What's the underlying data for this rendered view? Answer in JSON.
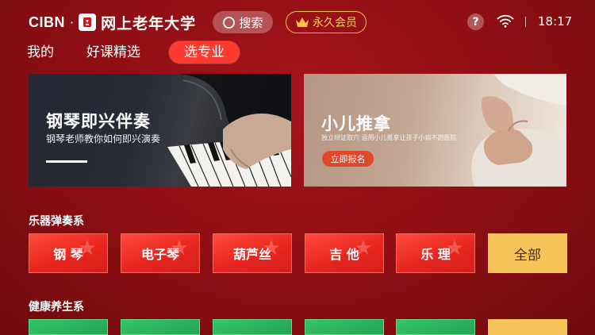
{
  "header": {
    "brand_cibn": "CIBN",
    "brand_dot": "·",
    "brand_name": "网上老年大学",
    "search_label": "搜索",
    "vip_label": "永久会员",
    "help_label": "?",
    "time": "18:17"
  },
  "tabs": [
    {
      "label": "我的",
      "active": false
    },
    {
      "label": "好课精选",
      "active": false
    },
    {
      "label": "选专业",
      "active": true
    }
  ],
  "banners": [
    {
      "title": "钢琴即兴伴奏",
      "subtitle": "钢琴老师教你如何即兴演奏"
    },
    {
      "title": "小儿推拿",
      "subtitle": "独立辩证取穴 运用小儿推拿让孩子小病不跑医院",
      "cta": "立即报名"
    }
  ],
  "sections": [
    {
      "title": "乐器弹奏系",
      "items": [
        "钢 琴",
        "电子琴",
        "葫芦丝",
        "吉 他",
        "乐 理"
      ],
      "all_label": "全部"
    },
    {
      "title": "健康养生系"
    }
  ],
  "colors": {
    "background": "#9a1217",
    "active_tab": "#ff3b2f",
    "vip_gold": "#f5c24a",
    "chip_red": "#e8261f",
    "chip_all": "#f7c45a",
    "chip_green": "#2bb35f"
  }
}
